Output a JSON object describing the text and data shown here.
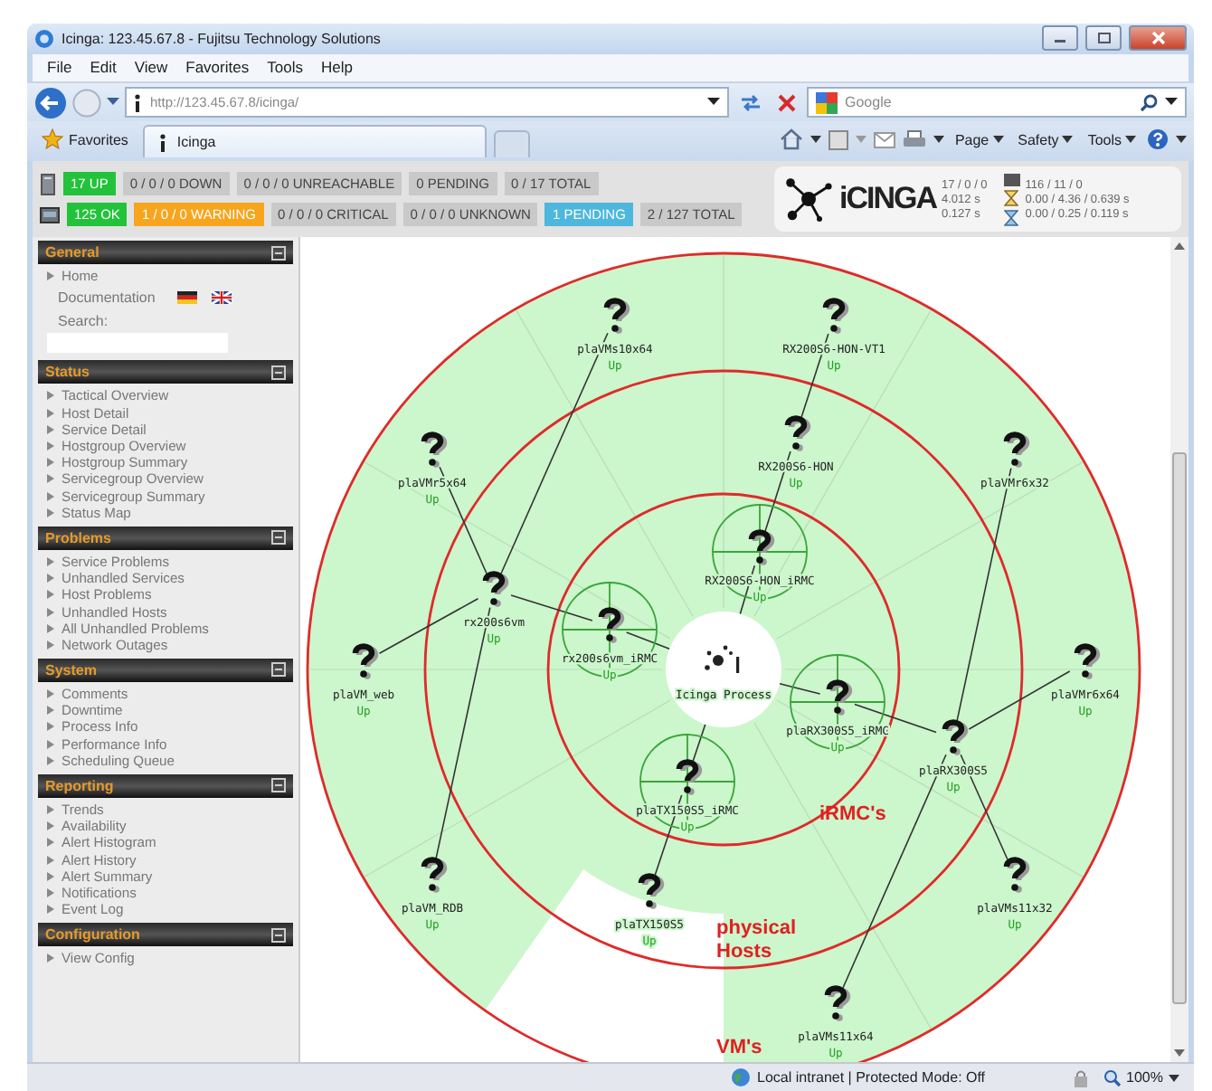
{
  "window": {
    "title": "Icinga: 123.45.67.8 - Fujitsu Technology Solutions"
  },
  "menu": [
    "File",
    "Edit",
    "View",
    "Favorites",
    "Tools",
    "Help"
  ],
  "address_bar": {
    "url": "http://123.45.67.8/icinga/"
  },
  "search": {
    "placeholder": "Google"
  },
  "favorites": {
    "label": "Favorites"
  },
  "tabs": [
    {
      "label": "Icinga",
      "selected": true
    }
  ],
  "command_bar": [
    "Page",
    "Safety",
    "Tools"
  ],
  "host_totals": [
    {
      "text": "17 UP",
      "kind": "ok"
    },
    {
      "text": "0 / 0 / 0 DOWN",
      "kind": "neutral"
    },
    {
      "text": "0 / 0 / 0 UNREACHABLE",
      "kind": "neutral"
    },
    {
      "text": "0 PENDING",
      "kind": "neutral"
    },
    {
      "text": "0 / 17 TOTAL",
      "kind": "neutral"
    }
  ],
  "service_totals": [
    {
      "text": "125 OK",
      "kind": "ok"
    },
    {
      "text": "1 / 0 / 0 WARNING",
      "kind": "warning"
    },
    {
      "text": "0 / 0 / 0 CRITICAL",
      "kind": "neutral"
    },
    {
      "text": "0 / 0 / 0 UNKNOWN",
      "kind": "neutral"
    },
    {
      "text": "1 PENDING",
      "kind": "pending"
    },
    {
      "text": "2 / 127 TOTAL",
      "kind": "neutral"
    }
  ],
  "performance": {
    "logo": "iCINGA",
    "host_checks": [
      "17 / 0 / 0",
      "4.012 s",
      "0.127 s"
    ],
    "service_checks": [
      "116 / 11 / 0",
      "0.00 / 4.36 / 0.639 s",
      "0.00 / 0.25 / 0.119 s"
    ]
  },
  "sidebar": [
    {
      "title": "General",
      "items": [
        {
          "label": "Home",
          "kind": "link"
        },
        {
          "label": "Documentation",
          "kind": "docs"
        },
        {
          "label": "Search:",
          "kind": "search"
        }
      ]
    },
    {
      "title": "Status",
      "items": [
        {
          "label": "Tactical Overview",
          "kind": "link"
        },
        {
          "label": "Host Detail",
          "kind": "link"
        },
        {
          "label": "Service Detail",
          "kind": "link"
        },
        {
          "label": "Hostgroup Overview",
          "kind": "link"
        },
        {
          "label": "Hostgroup Summary",
          "kind": "link"
        },
        {
          "label": "Servicegroup Overview",
          "kind": "link"
        },
        {
          "label": "Servicegroup Summary",
          "kind": "link"
        },
        {
          "label": "Status Map",
          "kind": "link"
        }
      ]
    },
    {
      "title": "Problems",
      "items": [
        {
          "label": "Service Problems",
          "kind": "link"
        },
        {
          "label": "Unhandled Services",
          "kind": "link"
        },
        {
          "label": "Host Problems",
          "kind": "link"
        },
        {
          "label": "Unhandled Hosts",
          "kind": "link"
        },
        {
          "label": "All Unhandled Problems",
          "kind": "link"
        },
        {
          "label": "Network Outages",
          "kind": "link"
        }
      ]
    },
    {
      "title": "System",
      "items": [
        {
          "label": "Comments",
          "kind": "link"
        },
        {
          "label": "Downtime",
          "kind": "link"
        },
        {
          "label": "Process Info",
          "kind": "link"
        },
        {
          "label": "Performance Info",
          "kind": "link"
        },
        {
          "label": "Scheduling Queue",
          "kind": "link"
        }
      ]
    },
    {
      "title": "Reporting",
      "items": [
        {
          "label": "Trends",
          "kind": "link"
        },
        {
          "label": "Availability",
          "kind": "link"
        },
        {
          "label": "Alert Histogram",
          "kind": "link"
        },
        {
          "label": "Alert History",
          "kind": "link"
        },
        {
          "label": "Alert Summary",
          "kind": "link"
        },
        {
          "label": "Notifications",
          "kind": "link"
        },
        {
          "label": "Event Log",
          "kind": "link"
        }
      ]
    },
    {
      "title": "Configuration",
      "items": [
        {
          "label": "View Config",
          "kind": "link"
        }
      ]
    }
  ],
  "map": {
    "root": {
      "name": "Icinga Process",
      "kind": "process",
      "children": [
        {
          "name": "rx200s6vm_iRMC",
          "status": "Up",
          "kind": "irmc",
          "children": [
            {
              "name": "rx200s6vm",
              "status": "Up",
              "kind": "host",
              "children": [
                {
                  "name": "plaVM_web",
                  "status": "Up",
                  "kind": "host"
                },
                {
                  "name": "plaVMr5x64",
                  "status": "Up",
                  "kind": "host"
                },
                {
                  "name": "plaVM_RDB",
                  "status": "Up",
                  "kind": "host"
                },
                {
                  "name": "plaVMs10x64",
                  "status": "Up",
                  "kind": "host"
                }
              ]
            }
          ]
        },
        {
          "name": "plaTX150S5_iRMC",
          "status": "Up",
          "kind": "irmc",
          "children": [
            {
              "name": "plaTX150S5",
              "status": "Up",
              "kind": "host"
            }
          ]
        },
        {
          "name": "RX200S6-HON_iRMC",
          "status": "Up",
          "kind": "irmc",
          "children": [
            {
              "name": "RX200S6-HON",
              "status": "Up",
              "kind": "host",
              "children": [
                {
                  "name": "RX200S6-HON-VT1",
                  "status": "Up",
                  "kind": "host"
                }
              ]
            }
          ]
        },
        {
          "name": "plaRX300S5_iRMC",
          "status": "Up",
          "kind": "irmc",
          "children": [
            {
              "name": "plaRX300S5",
              "status": "Up",
              "kind": "host",
              "children": [
                {
                  "name": "plaVMs11x64",
                  "status": "Up",
                  "kind": "host"
                },
                {
                  "name": "plaVMr6x32",
                  "kind": "host"
                },
                {
                  "name": "plaVMs11x32",
                  "status": "Up",
                  "kind": "host"
                },
                {
                  "name": "plaVMr6x64",
                  "status": "Up",
                  "kind": "host"
                }
              ]
            }
          ]
        }
      ]
    },
    "ring_labels": [
      {
        "lines": [
          "iRMC's"
        ]
      },
      {
        "lines": [
          "physical",
          "Hosts"
        ]
      },
      {
        "lines": [
          "VM's"
        ]
      }
    ]
  },
  "status_bar": {
    "zone": "Local intranet | Protected Mode: Off",
    "zoom": "100%"
  }
}
